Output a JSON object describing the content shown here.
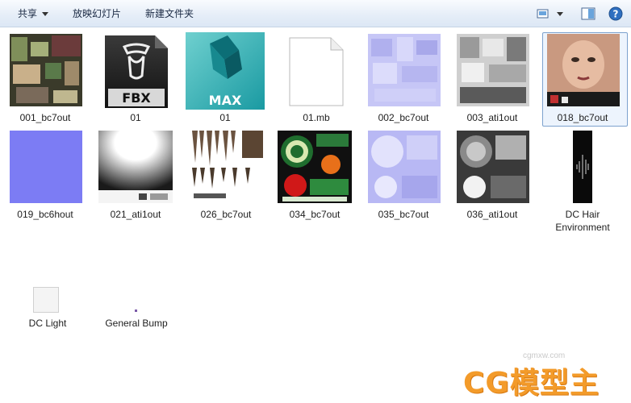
{
  "toolbar": {
    "share_label": "共享",
    "slideshow_label": "放映幻灯片",
    "new_folder_label": "新建文件夹"
  },
  "files": [
    {
      "name": "001_bc7out",
      "kind": "texture-dark"
    },
    {
      "name": "01",
      "kind": "fbx"
    },
    {
      "name": "01",
      "kind": "max"
    },
    {
      "name": "01.mb",
      "kind": "blank-doc"
    },
    {
      "name": "002_bc7out",
      "kind": "texture-lilac"
    },
    {
      "name": "003_ati1out",
      "kind": "texture-gray"
    },
    {
      "name": "018_bc7out",
      "kind": "texture-face"
    },
    {
      "name": "019_bc6hout",
      "kind": "texture-blue"
    },
    {
      "name": "021_ati1out",
      "kind": "texture-white"
    },
    {
      "name": "026_bc7out",
      "kind": "texture-hair"
    },
    {
      "name": "034_bc7out",
      "kind": "texture-eye"
    },
    {
      "name": "035_bc7out",
      "kind": "texture-lilac-eye"
    },
    {
      "name": "036_ati1out",
      "kind": "texture-gray-eye"
    },
    {
      "name": "DC Hair Environment",
      "kind": "texture-strip"
    },
    {
      "name": "DC Light",
      "kind": "small-white"
    },
    {
      "name": "General Bump",
      "kind": "tiny-dot"
    }
  ],
  "thumb_texts": {
    "fbx": "FBX",
    "max": "MAX"
  },
  "watermark": {
    "brand": "CG模型主",
    "url": "cgmxw.com"
  },
  "colors": {
    "toolbar_top": "#f9fbfe",
    "toolbar_bottom": "#dce7f5",
    "selection": "#7da2ce",
    "max_teal": "#1fa0a6",
    "normal_blue": "#7c7cf4"
  },
  "icons": [
    "dropdown-caret-icon",
    "view-options-icon",
    "preview-pane-icon",
    "help-icon"
  ]
}
